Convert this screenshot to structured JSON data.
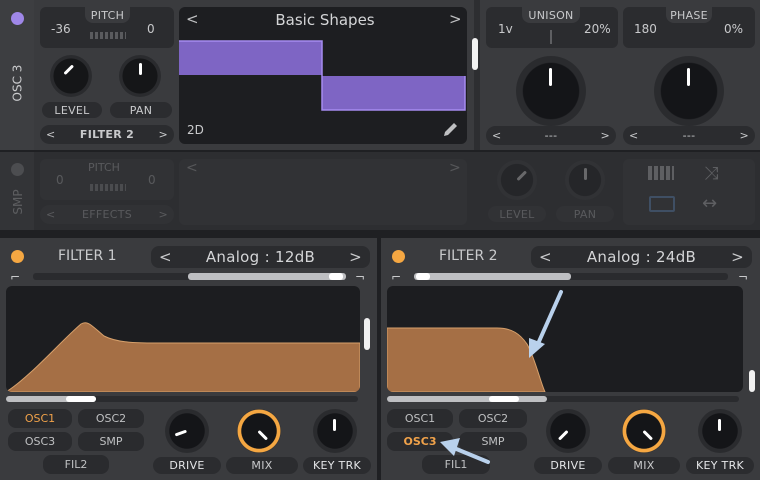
{
  "osc3": {
    "title": "OSC 3",
    "pitch_label": "PITCH",
    "pitch_left": "-36",
    "pitch_right": "0",
    "wavetable_name": "Basic Shapes",
    "wavetable_mode": "2D",
    "level_label": "LEVEL",
    "pan_label": "PAN",
    "dest": "FILTER 2",
    "unison_label": "UNISON",
    "unison_voices": "1v",
    "unison_detune": "20%",
    "unison_dest": "---",
    "phase_label": "PHASE",
    "phase_value": "180",
    "phase_random": "0%",
    "phase_dest": "---"
  },
  "smp": {
    "title": "SMP",
    "pitch_label": "PITCH",
    "pitch_left": "0",
    "pitch_right": "0",
    "dest": "EFFECTS",
    "level_label": "LEVEL",
    "pan_label": "PAN"
  },
  "filter1": {
    "title": "FILTER 1",
    "model": "Analog",
    "sep": ":",
    "slope": "12dB",
    "osc1": "OSC1",
    "osc2": "OSC2",
    "osc3": "OSC3",
    "smp": "SMP",
    "fil": "FIL2",
    "drive": "DRIVE",
    "mix": "MIX",
    "keytrk": "KEY TRK"
  },
  "filter2": {
    "title": "FILTER 2",
    "model": "Analog",
    "sep": ":",
    "slope": "24dB",
    "osc1": "OSC1",
    "osc2": "OSC2",
    "osc3": "OSC3",
    "smp": "SMP",
    "fil": "FIL1",
    "drive": "DRIVE",
    "mix": "MIX",
    "keytrk": "KEY TRK"
  },
  "icons": {
    "arrow_left": "<",
    "arrow_right": ">"
  },
  "colors": {
    "osc_accent": "#9f87e8",
    "filter_accent": "#f5a742",
    "filter_curve": "#a56f45",
    "annotation_arrow": "#b9d1ec"
  }
}
